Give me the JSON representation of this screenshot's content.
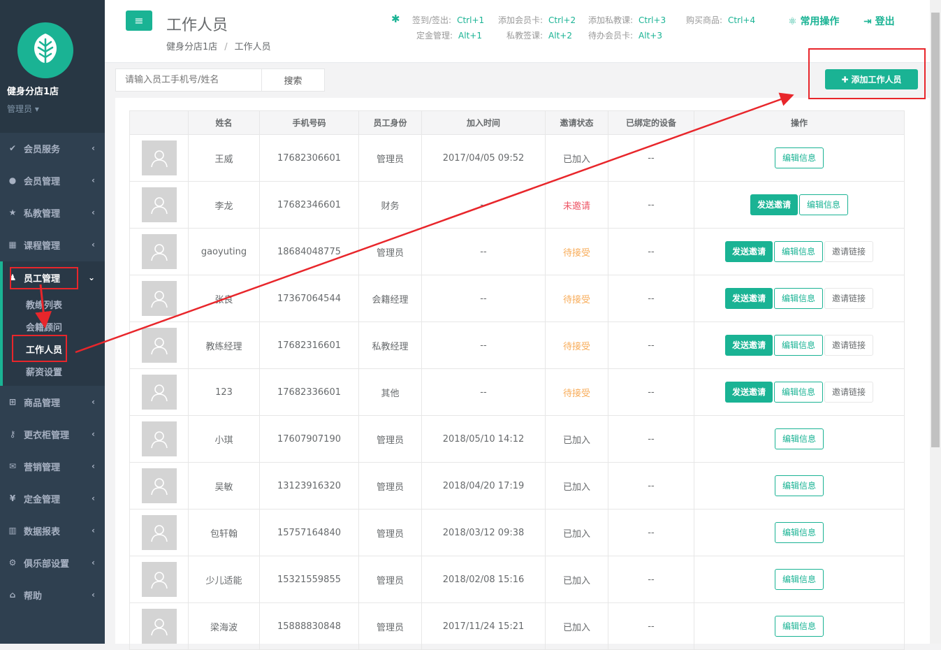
{
  "sidebar": {
    "store_name": "健身分店1店",
    "role": "管理员",
    "items": [
      {
        "label": "会员服务",
        "icon": "check-icon"
      },
      {
        "label": "会员管理",
        "icon": "user-icon"
      },
      {
        "label": "私教管理",
        "icon": "star-icon"
      },
      {
        "label": "课程管理",
        "icon": "calendar-icon"
      },
      {
        "label": "员工管理",
        "icon": "staff-icon"
      },
      {
        "label": "商品管理",
        "icon": "cart-icon"
      },
      {
        "label": "更衣柜管理",
        "icon": "key-icon"
      },
      {
        "label": "营销管理",
        "icon": "envelope-icon"
      },
      {
        "label": "定金管理",
        "icon": "yen-icon"
      },
      {
        "label": "数据报表",
        "icon": "bar-chart-icon"
      },
      {
        "label": "俱乐部设置",
        "icon": "gear-icon"
      },
      {
        "label": "帮助",
        "icon": "graduation-cap-icon"
      }
    ],
    "sub_items": [
      "教练列表",
      "会籍顾问",
      "工作人员",
      "薪资设置"
    ]
  },
  "header": {
    "title": "工作人员",
    "breadcrumb": [
      "健身分店1店",
      "工作人员"
    ],
    "shortcuts": [
      {
        "label": "签到/签出:",
        "key": "Ctrl+1"
      },
      {
        "label": "添加会员卡:",
        "key": "Ctrl+2"
      },
      {
        "label": "添加私教课:",
        "key": "Ctrl+3"
      },
      {
        "label": "购买商品:",
        "key": "Ctrl+4"
      },
      {
        "label": "定金管理:",
        "key": "Alt+1"
      },
      {
        "label": "私教签课:",
        "key": "Alt+2"
      },
      {
        "label": "待办会员卡:",
        "key": "Alt+3"
      }
    ],
    "common_ops": "常用操作",
    "logout": "登出"
  },
  "search": {
    "placeholder": "请输入员工手机号/姓名",
    "button": "搜索"
  },
  "add_button": "添加工作人员",
  "table": {
    "headers": [
      "",
      "姓名",
      "手机号码",
      "员工身份",
      "加入时间",
      "邀请状态",
      "已绑定的设备",
      "操作"
    ],
    "rows": [
      {
        "name": "王威",
        "phone": "17682306601",
        "role": "管理员",
        "time": "2017/04/05 09:52",
        "status": "已加入",
        "device": "--"
      },
      {
        "name": "李龙",
        "phone": "17682346601",
        "role": "财务",
        "time": "--",
        "status": "未邀请",
        "device": "--"
      },
      {
        "name": "gaoyuting",
        "phone": "18684048775",
        "role": "管理员",
        "time": "--",
        "status": "待接受",
        "device": "--"
      },
      {
        "name": "张良",
        "phone": "17367064544",
        "role": "会籍经理",
        "time": "--",
        "status": "待接受",
        "device": "--"
      },
      {
        "name": "教练经理",
        "phone": "17682316601",
        "role": "私教经理",
        "time": "--",
        "status": "待接受",
        "device": "--"
      },
      {
        "name": "123",
        "phone": "17682336601",
        "role": "其他",
        "time": "--",
        "status": "待接受",
        "device": "--"
      },
      {
        "name": "小琪",
        "phone": "17607907190",
        "role": "管理员",
        "time": "2018/05/10 14:12",
        "status": "已加入",
        "device": "--"
      },
      {
        "name": "吴敏",
        "phone": "13123916320",
        "role": "管理员",
        "time": "2018/04/20 17:19",
        "status": "已加入",
        "device": "--"
      },
      {
        "name": "包轩翰",
        "phone": "15757164840",
        "role": "管理员",
        "time": "2018/03/12 09:38",
        "status": "已加入",
        "device": "--"
      },
      {
        "name": "少儿适能",
        "phone": "15321559855",
        "role": "管理员",
        "time": "2018/02/08 15:16",
        "status": "已加入",
        "device": "--"
      },
      {
        "name": "梁海波",
        "phone": "15888830848",
        "role": "管理员",
        "time": "2017/11/24 15:21",
        "status": "已加入",
        "device": "--"
      }
    ],
    "actions": {
      "send": "发送邀请",
      "edit": "编辑信息",
      "link": "邀请链接"
    }
  },
  "colors": {
    "accent": "#1ab394",
    "sidebar": "#2f4050",
    "annotation": "#e8262b"
  }
}
